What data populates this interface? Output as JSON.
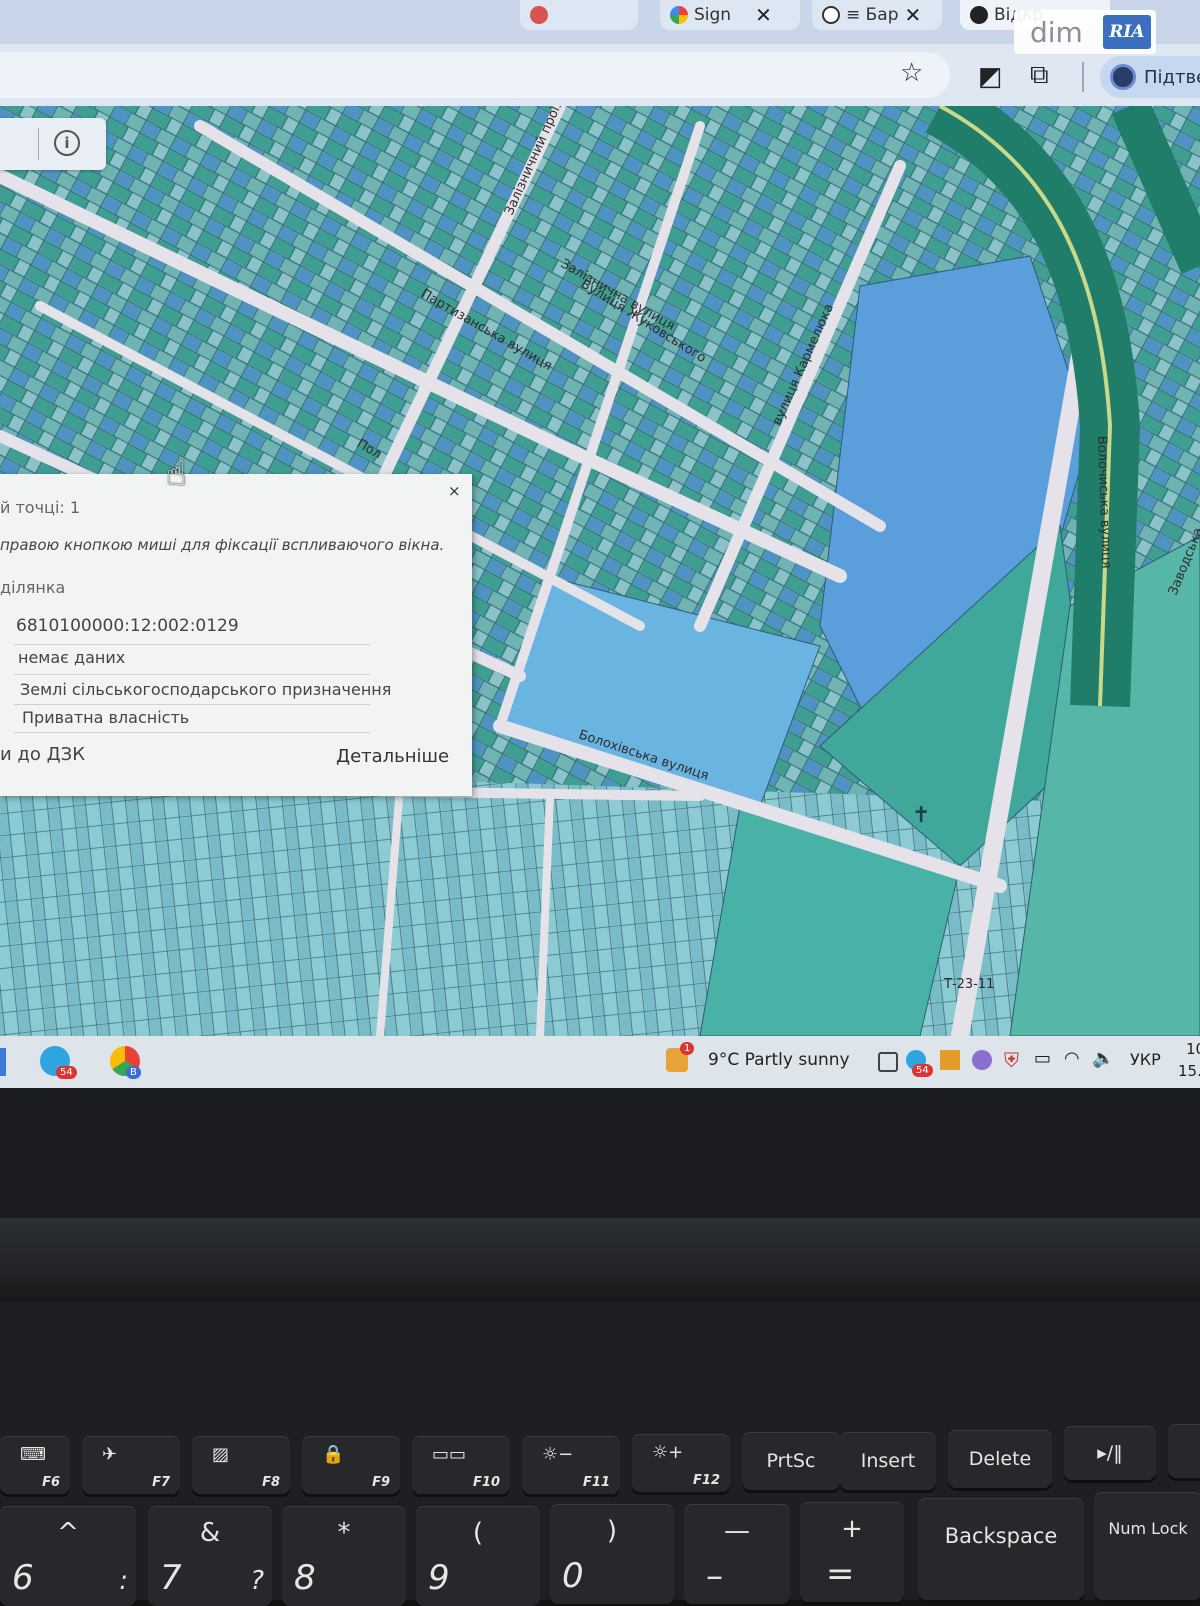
{
  "browser": {
    "tabs": [
      {
        "label": "Sign",
        "icon": "google-icon"
      },
      {
        "label": "≡ Бар",
        "icon": "shield-icon"
      },
      {
        "label": "Відкр",
        "icon": "globe-icon"
      }
    ],
    "profile_label": "Підтве",
    "toolbar_icons": [
      "star-icon",
      "extension-icon",
      "puzzle-icon"
    ]
  },
  "watermark": {
    "left": "dim",
    "right": "RIA"
  },
  "map": {
    "street_labels": [
      "Залізничний проїзд",
      "Залізнична вулиця",
      "Партизанська вулиця",
      "Вулиця Жуковського",
      "вулиця Кармелюка",
      "Волочиська вулиця",
      "Болохівська вулиця",
      "Заводська",
      "Пол",
      "Т-23-11"
    ],
    "colors": {
      "parcel_teal": "#3e9a92",
      "parcel_blue": "#4d8fcf",
      "road": "#e4e1e8",
      "railway": "#1f7d6a"
    }
  },
  "popup": {
    "close_label": "×",
    "title": "й точці: 1",
    "hint": "правою кнопкою миші для фіксації вспливаючого вікна.",
    "section": "ділянка",
    "cadastral_number": "6810100000:12:002:0129",
    "purpose_code": "немає даних",
    "category": "Землі сільськогосподарського призначення",
    "ownership": "Приватна власність",
    "dzk_link": "и до ДЗК",
    "details_link": "Детальніше"
  },
  "taskbar": {
    "telegram_badge": "54",
    "chrome_badge": "B",
    "weather_badge": "1",
    "weather": "9°C  Partly sunny",
    "tray_badge": "54",
    "language": "УКР",
    "time_partial": "10",
    "date_partial": "15.0"
  },
  "keyboard": {
    "function_keys": [
      {
        "glyph": "⌨",
        "label": "F6"
      },
      {
        "glyph": "✈",
        "label": "F7"
      },
      {
        "glyph": "▨",
        "label": "F8"
      },
      {
        "glyph": "🔒",
        "label": "F9"
      },
      {
        "glyph": "▭▭",
        "label": "F10"
      },
      {
        "glyph": "☼−",
        "label": "F11"
      },
      {
        "glyph": "☼+",
        "label": "F12"
      },
      {
        "glyph": "",
        "label": "PrtSc"
      },
      {
        "glyph": "",
        "label": "Insert"
      },
      {
        "glyph": "",
        "label": "Delete"
      },
      {
        "glyph": "▸/‖",
        "label": ""
      }
    ],
    "number_keys": [
      {
        "top": "^",
        "bottom": "6",
        "side": ":"
      },
      {
        "top": "&",
        "bottom": "7",
        "side": "?"
      },
      {
        "top": "*",
        "bottom": "8",
        "side": ""
      },
      {
        "top": "(",
        "bottom": "9",
        "side": ""
      },
      {
        "top": ")",
        "bottom": "0",
        "side": ""
      },
      {
        "top": "—",
        "bottom": "–",
        "side": ""
      },
      {
        "top": "+",
        "bottom": "=",
        "side": ""
      }
    ],
    "backspace": "Backspace",
    "numlock": "Num Lock"
  }
}
